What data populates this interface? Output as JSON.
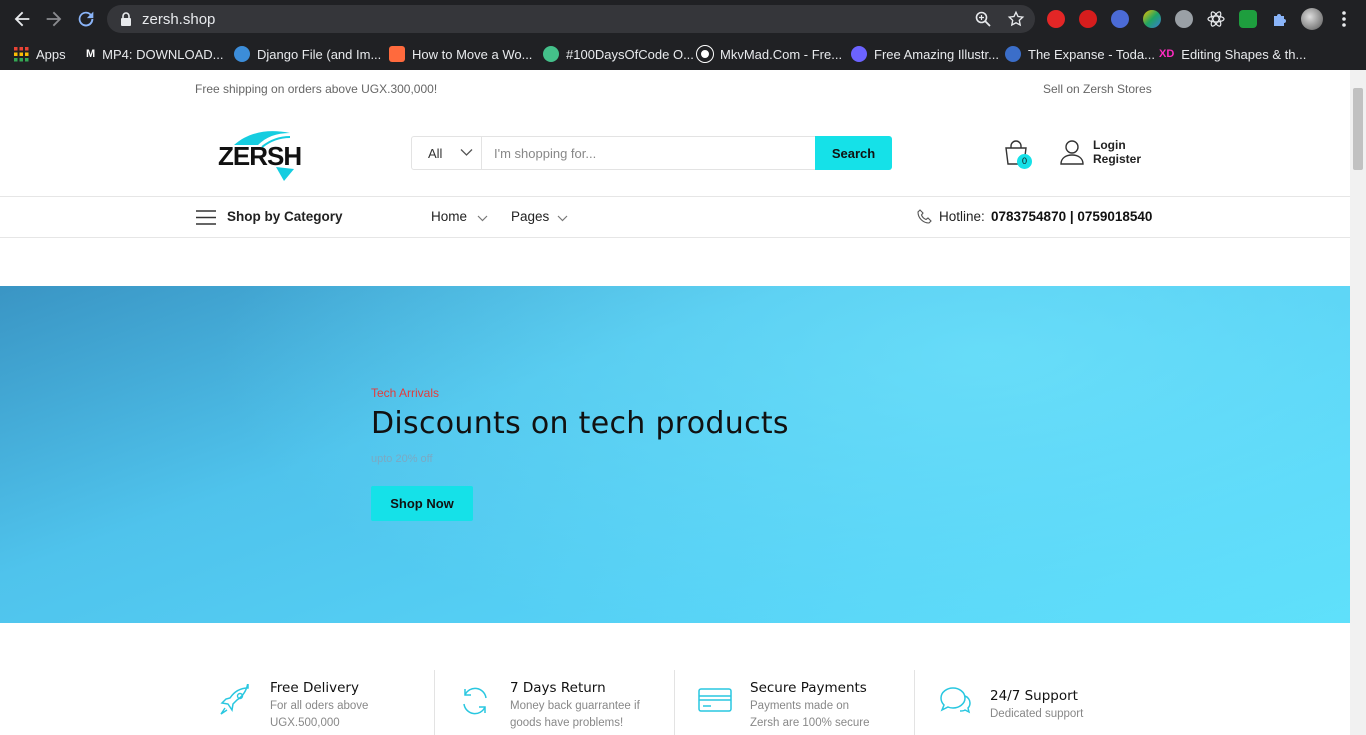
{
  "browser": {
    "url": "zersh.shop",
    "bookmarks": [
      {
        "label": "Apps",
        "color": "#ea4335"
      },
      {
        "label": "MP4: DOWNLOAD...",
        "color": "#ffffff"
      },
      {
        "label": "Django File (and Im...",
        "color": "#3c8dd9"
      },
      {
        "label": "How to Move a Wo...",
        "color": "#ff6a3d"
      },
      {
        "label": "#100DaysOfCode O...",
        "color": "#44c08a"
      },
      {
        "label": "MkvMad.Com - Fre...",
        "color": "#ffffff"
      },
      {
        "label": "Free Amazing Illustr...",
        "color": "#6c63ff"
      },
      {
        "label": "The Expanse - Toda...",
        "color": "#3b6ec9"
      },
      {
        "label": "Editing Shapes & th...",
        "color": "#ff2bc2"
      }
    ],
    "extensions": [
      "abp",
      "cursor",
      "translate",
      "drive",
      "cloud",
      "react",
      "sg",
      "puzzle",
      "profile"
    ]
  },
  "topbar": {
    "shipping": "Free shipping on orders above UGX.300,000!",
    "sell": "Sell on Zersh Stores"
  },
  "header": {
    "logo": "ZERSH",
    "search_category": "All",
    "search_placeholder": "I'm shopping for...",
    "search_button": "Search",
    "cart_count": "0",
    "login": "Login",
    "register": "Register"
  },
  "nav": {
    "category": "Shop by Category",
    "home": "Home",
    "pages": "Pages",
    "hotline_label": "Hotline:",
    "hotline_numbers": "0783754870 | 0759018540"
  },
  "hero": {
    "kicker": "Tech Arrivals",
    "title": "Discounts on tech products",
    "subtitle": "upto 20% off",
    "button": "Shop Now"
  },
  "features": [
    {
      "title": "Free Delivery",
      "desc1": "For all oders above",
      "desc2": "UGX.500,000",
      "icon": "rocket-icon"
    },
    {
      "title": "7 Days Return",
      "desc1": "Money back guarrantee if",
      "desc2": "goods have problems!",
      "icon": "refresh-icon"
    },
    {
      "title": "Secure Payments",
      "desc1": "Payments made on",
      "desc2": "Zersh are 100% secure",
      "icon": "credit-card-icon"
    },
    {
      "title": "24/7 Support",
      "desc1": "Dedicated support",
      "desc2": "",
      "icon": "chat-icon"
    }
  ],
  "colors": {
    "accent": "#15e1e8",
    "hero_kicker": "#e43b3b",
    "chrome_bg": "#202124"
  }
}
